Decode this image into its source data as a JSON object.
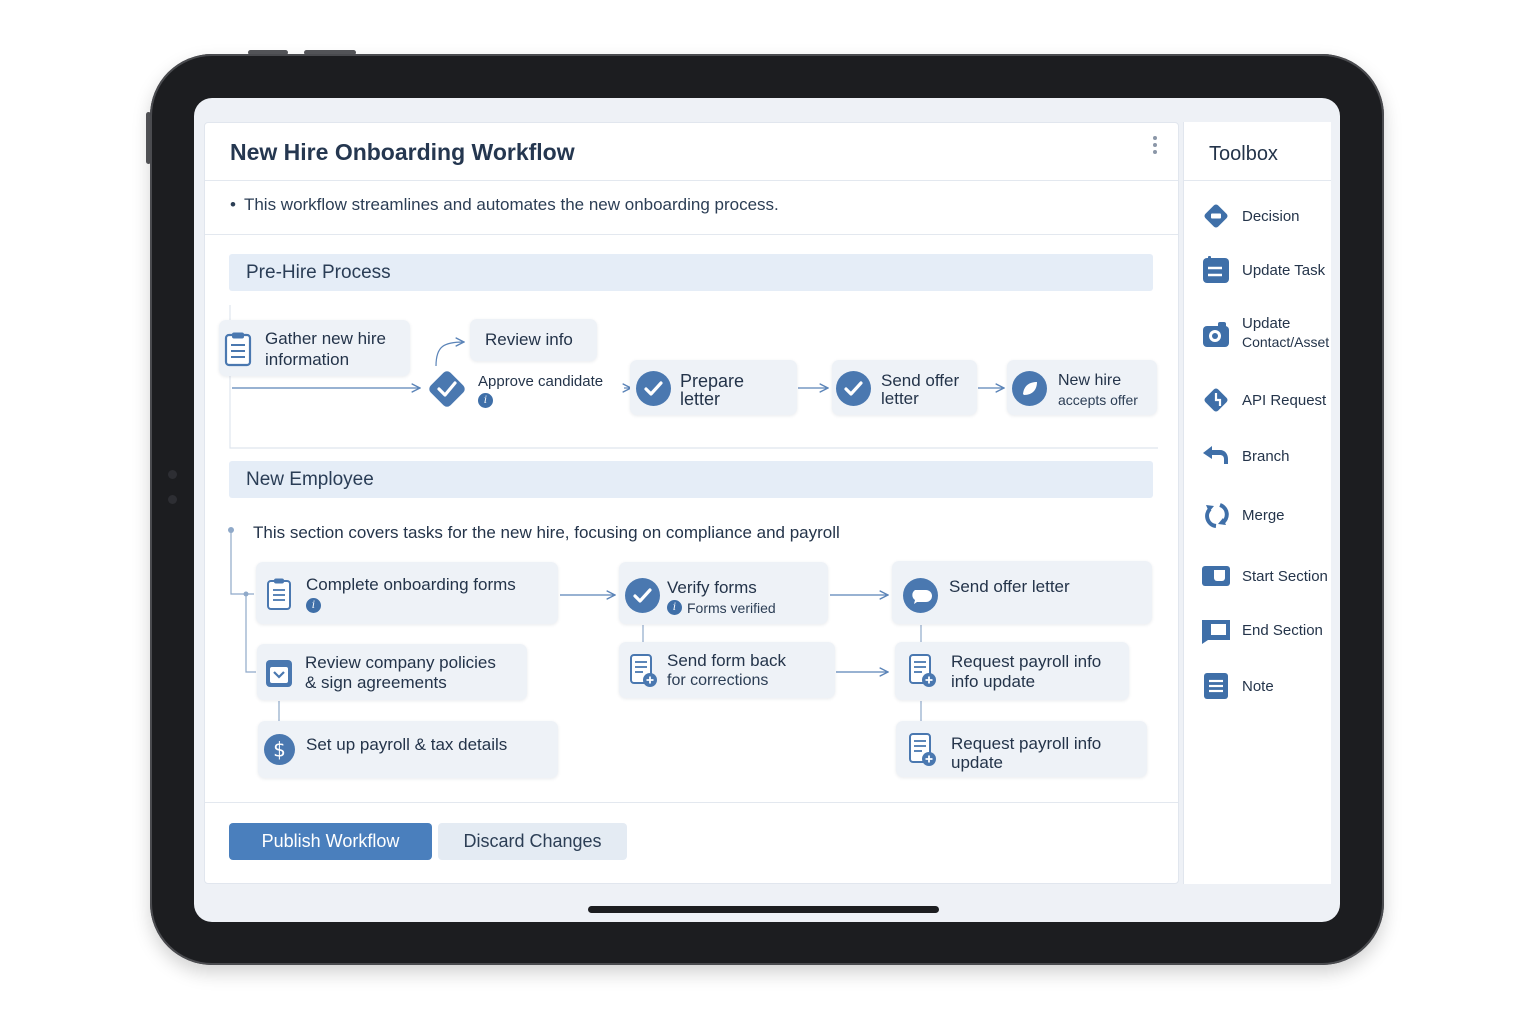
{
  "workflow": {
    "title": "New Hire Onboarding Workflow",
    "description": "This workflow streamlines and automates the new onboarding process."
  },
  "pre_hire": {
    "section_title": "Pre-Hire Process",
    "gather": "Gather new hire information",
    "gather_line1": "Gather new hire",
    "gather_line2": "information",
    "review_info": "Review info",
    "approve": "Approve candidate",
    "prepare_line1": "Prepare",
    "prepare_line2": "letter",
    "send_offer_line1": "Send offer",
    "send_offer_line2": "letter",
    "accepts_line1": "New hire",
    "accepts_line2": "accepts offer"
  },
  "new_employee": {
    "section_title": "New Employee",
    "description": "This section covers tasks for the new hire, focusing on compliance and payroll",
    "complete_forms": "Complete onboarding forms",
    "verify_forms": "Verify forms",
    "verify_sub": "Forms verified",
    "send_offer": "Send offer letter",
    "review_policies_line1": "Review company policies",
    "review_policies_line2": "& sign agreements",
    "send_back_line1": "Send form back",
    "send_back_line2": "for corrections",
    "payroll_update1_line1": "Request payroll info",
    "payroll_update1_line2": "info update",
    "payroll_tax": "Set up payroll & tax details",
    "payroll_update2_line1": "Request payroll info",
    "payroll_update2_line2": "update"
  },
  "info_glyph": "i",
  "toolbox": {
    "title": "Toolbox",
    "items": [
      {
        "label": "Decision",
        "icon": "diamond-icon"
      },
      {
        "label": "Update Task",
        "icon": "task-icon"
      },
      {
        "label": "Update",
        "label2": "Contact/Asset",
        "icon": "camera-icon"
      },
      {
        "label": "API Request",
        "icon": "api-diamond-icon"
      },
      {
        "label": "Branch",
        "icon": "branch-arrow-icon"
      },
      {
        "label": "Merge",
        "icon": "merge-icon"
      },
      {
        "label": "Start Section",
        "icon": "start-section-icon"
      },
      {
        "label": "End Section",
        "icon": "end-section-icon"
      },
      {
        "label": "Note",
        "icon": "note-icon"
      }
    ]
  },
  "actions": {
    "publish": "Publish Workflow",
    "discard": "Discard Changes"
  },
  "colors": {
    "accent": "#4a78b0",
    "primary_button": "#4a7fbd",
    "node_bg": "#eef2f7",
    "section_bg": "#e5edf7"
  }
}
